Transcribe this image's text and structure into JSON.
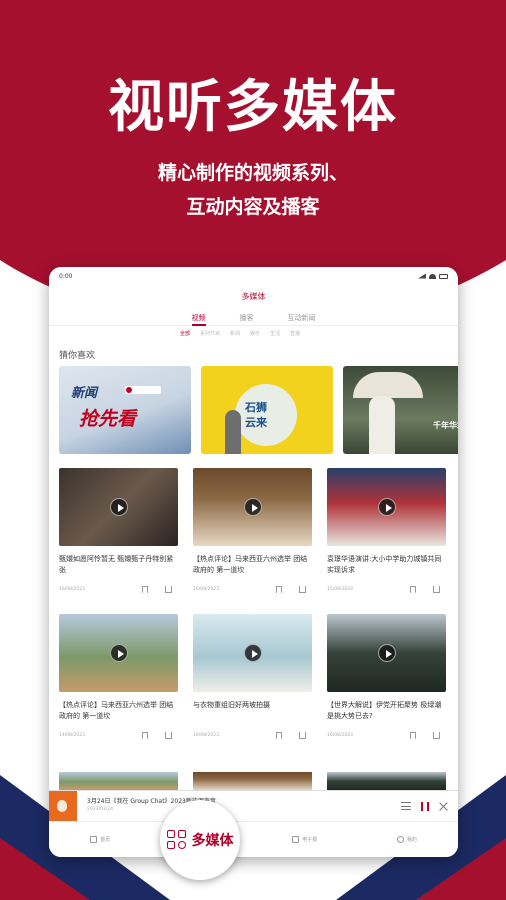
{
  "hero": {
    "title": "视听多媒体",
    "subtitle_line1": "精心制作的视频系列、",
    "subtitle_line2": "互动内容及播客"
  },
  "tablet": {
    "status_time": "0:00",
    "app_title": "多媒体",
    "tabs": [
      {
        "label": "视频",
        "active": true
      },
      {
        "label": "播客",
        "active": false
      },
      {
        "label": "互动新闻",
        "active": false
      }
    ],
    "subtabs": [
      {
        "label": "全部",
        "active": true
      },
      {
        "label": "系列节目",
        "active": false
      },
      {
        "label": "新闻",
        "active": false
      },
      {
        "label": "娱乐",
        "active": false
      },
      {
        "label": "生活",
        "active": false
      },
      {
        "label": "直播",
        "active": false
      }
    ],
    "section_title": "猜你喜欢",
    "categories": [
      {
        "text1": "新闻",
        "text2": "抢先看"
      },
      {
        "text": "石狮\n云来"
      },
      {
        "text": "千年华裳"
      }
    ],
    "cards": [
      {
        "title": "甄嬛如愿阿怜暂无 甄嬛甄子丹特别紧张",
        "date": "16/08/2023"
      },
      {
        "title": "【热点评论】马来西亚六州选举 团结政府的 第一道坎",
        "date": "16/08/2023"
      },
      {
        "title": "袁璟华语演讲:大小中学助力城镇共同实现诉求",
        "date": "15/08/2023"
      },
      {
        "title": "【热点评论】马来西亚六州选举 团结政府的 第一道坎",
        "date": "14/08/2023"
      },
      {
        "title": "与衣物重组旧好两坡拍摄",
        "date": "16/08/2023"
      },
      {
        "title": "【世界大解说】伊党开拓聚势 极绿潮是挑大势已去?",
        "date": "16/08/2023"
      }
    ],
    "audio_player": {
      "title": "3月24日《我在 Group Chat》2023新能源声音",
      "date": "2023/03/24"
    },
    "nav": {
      "home": "首页",
      "fab_label": "多媒体",
      "epaper": "电子报",
      "me": "我的"
    }
  }
}
